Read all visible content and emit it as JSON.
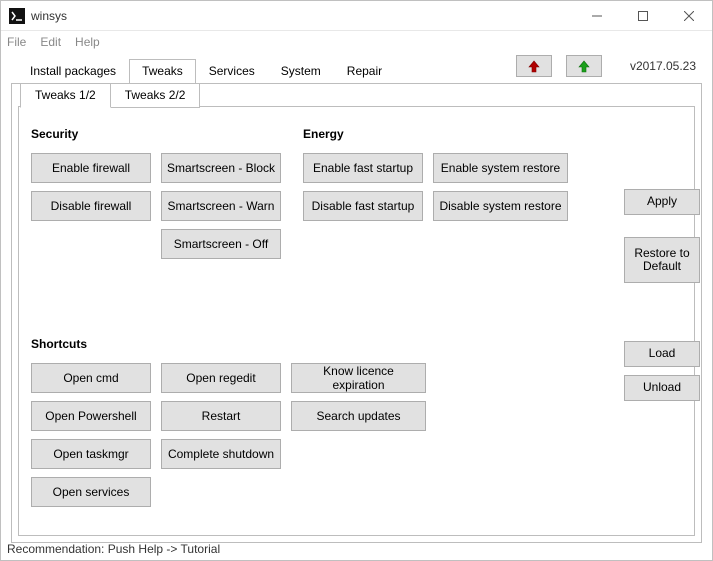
{
  "window": {
    "title": "winsys",
    "version": "v2017.05.23"
  },
  "menubar": {
    "file": "File",
    "edit": "Edit",
    "help": "Help"
  },
  "top_tabs": {
    "install": "Install packages",
    "tweaks": "Tweaks",
    "services": "Services",
    "system": "System",
    "repair": "Repair"
  },
  "sub_tabs": {
    "t1": "Tweaks 1/2",
    "t2": "Tweaks 2/2"
  },
  "sections": {
    "security": "Security",
    "energy": "Energy",
    "shortcuts": "Shortcuts"
  },
  "buttons": {
    "enable_firewall": "Enable firewall",
    "disable_firewall": "Disable firewall",
    "smartscreen_block": "Smartscreen - Block",
    "smartscreen_warn": "Smartscreen - Warn",
    "smartscreen_off": "Smartscreen - Off",
    "enable_fast_startup": "Enable fast startup",
    "disable_fast_startup": "Disable fast startup",
    "enable_system_restore": "Enable system restore",
    "disable_system_restore": "Disable system restore",
    "open_cmd": "Open cmd",
    "open_powershell": "Open Powershell",
    "open_taskmgr": "Open taskmgr",
    "open_services": "Open services",
    "open_regedit": "Open regedit",
    "restart": "Restart",
    "complete_shutdown": "Complete shutdown",
    "know_licence": "Know licence expiration",
    "search_updates": "Search updates"
  },
  "side": {
    "apply": "Apply",
    "restore": "Restore to Default",
    "load": "Load",
    "unload": "Unload"
  },
  "statusbar": "Recommendation: Push Help -> Tutorial"
}
